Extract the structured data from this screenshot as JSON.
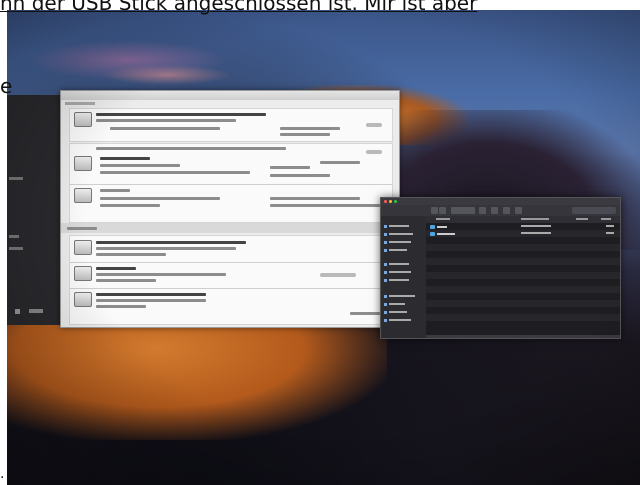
{
  "caption": {
    "top_line": "nn der USB Stick angeschlossen ist. Mir ist aber",
    "left_fragment": "e",
    "bottom_fragment": "."
  },
  "disk_window": {
    "title": "",
    "sections": [],
    "cards": []
  },
  "finder": {
    "title": "",
    "columns": [],
    "rows": []
  },
  "colors": {
    "accent_blue": "#4aa6e6",
    "window_bg": "#ececec",
    "finder_bg": "#232327",
    "desert_orange": "#d27a2e"
  },
  "icons": [
    "disk-icon",
    "folder-icon",
    "traffic-light-icon",
    "search-icon"
  ]
}
